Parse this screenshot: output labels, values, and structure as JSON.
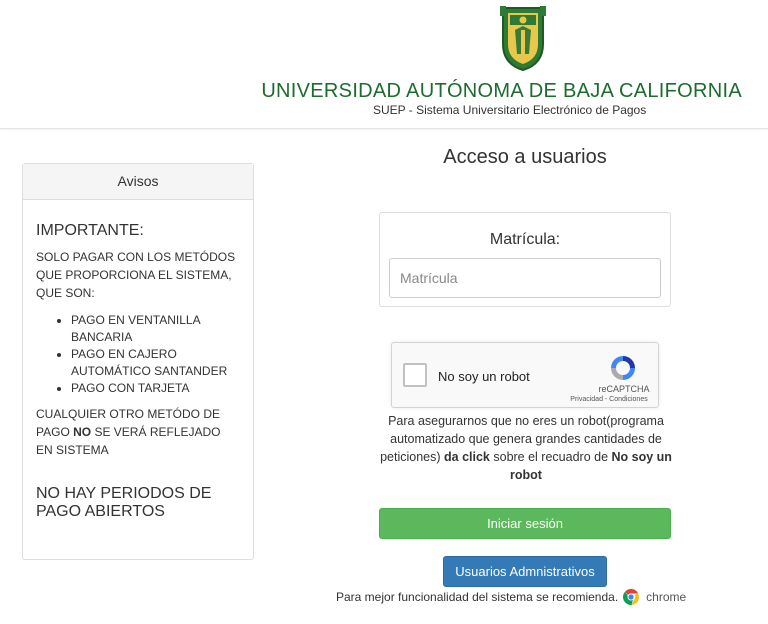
{
  "header": {
    "university": "UNIVERSIDAD AUTÓNOMA DE BAJA CALIFORNIA",
    "subtitle": "SUEP - Sistema Universitario Electrónico de Pagos"
  },
  "notices": {
    "title": "Avisos",
    "important": "IMPORTANTE:",
    "intro": "SOLO PAGAR CON LOS METÓDOS QUE PROPORCIONA EL SISTEMA, QUE SON:",
    "methods": [
      "PAGO EN VENTANILLA BANCARIA",
      "PAGO EN CAJERO AUTOMÁTICO SANTANDER",
      "PAGO CON TARJETA"
    ],
    "warning_before": "CUALQUIER OTRO METÓDO DE PAGO ",
    "warning_bold": "NO",
    "warning_after": " SE VERÁ REFLEJADO EN SISTEMA",
    "no_periods": "NO HAY PERIODOS DE PAGO ABIERTOS"
  },
  "login": {
    "title": "Acceso a usuarios",
    "matricula_label": "Matrícula:",
    "matricula_placeholder": "Matrícula",
    "matricula_value": ""
  },
  "captcha": {
    "label": "No soy un robot",
    "brand": "reCAPTCHA",
    "links": "Privacidad - Condiciones"
  },
  "explanation": {
    "part1": "Para asegurarnos que no eres un robot(programa automatizado que genera grandes cantidades de peticiones) ",
    "bold1": "da click",
    "part2": " sobre el recuadro de ",
    "bold2": "No soy un robot"
  },
  "buttons": {
    "login": "Iniciar sesión",
    "admin": "Usuarios Admnistrativos"
  },
  "footer": {
    "recommend": "Para mejor funcionalidad del sistema se recomienda.",
    "browser": "chrome"
  },
  "colors": {
    "brand_green": "#1d6b2e",
    "login_button": "#5cb85c",
    "admin_button": "#337ab7"
  }
}
